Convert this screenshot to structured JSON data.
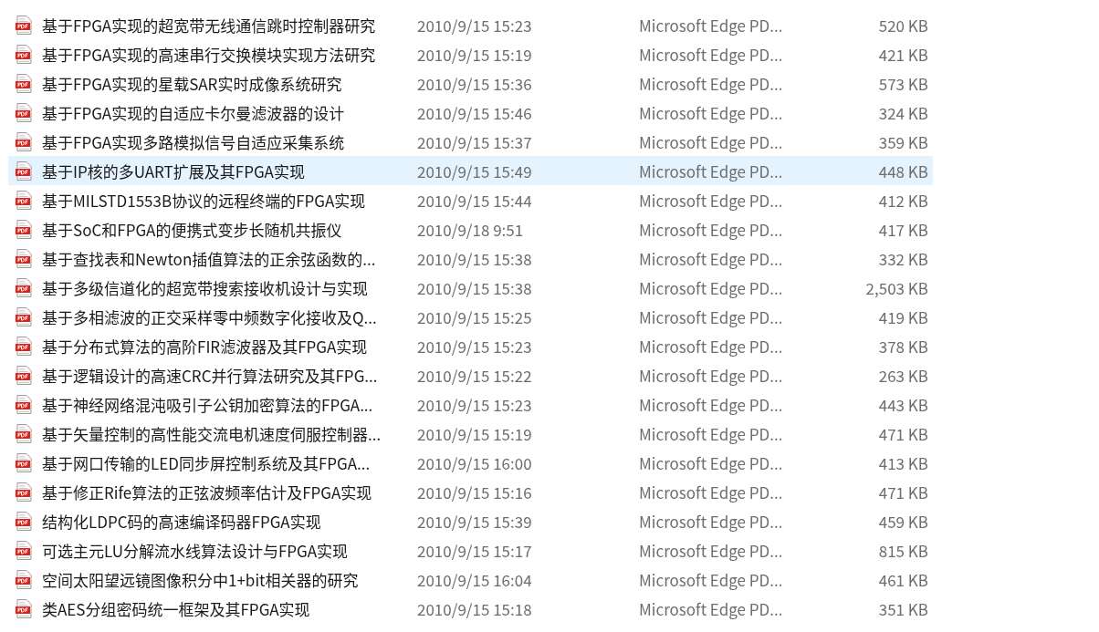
{
  "files": [
    {
      "name": "基于FPGA实现的超宽带无线通信跳时控制器研究",
      "date": "2010/9/15 15:23",
      "type": "Microsoft Edge PD...",
      "size": "520 KB",
      "highlighted": false
    },
    {
      "name": "基于FPGA实现的高速串行交换模块实现方法研究",
      "date": "2010/9/15 15:19",
      "type": "Microsoft Edge PD...",
      "size": "421 KB",
      "highlighted": false
    },
    {
      "name": "基于FPGA实现的星载SAR实时成像系统研究",
      "date": "2010/9/15 15:36",
      "type": "Microsoft Edge PD...",
      "size": "573 KB",
      "highlighted": false
    },
    {
      "name": "基于FPGA实现的自适应卡尔曼滤波器的设计",
      "date": "2010/9/15 15:46",
      "type": "Microsoft Edge PD...",
      "size": "324 KB",
      "highlighted": false
    },
    {
      "name": "基于FPGA实现多路模拟信号自适应采集系统",
      "date": "2010/9/15 15:37",
      "type": "Microsoft Edge PD...",
      "size": "359 KB",
      "highlighted": false
    },
    {
      "name": "基于IP核的多UART扩展及其FPGA实现",
      "date": "2010/9/15 15:49",
      "type": "Microsoft Edge PD...",
      "size": "448 KB",
      "highlighted": true
    },
    {
      "name": "基于MILSTD1553B协议的远程终端的FPGA实现",
      "date": "2010/9/15 15:44",
      "type": "Microsoft Edge PD...",
      "size": "412 KB",
      "highlighted": false
    },
    {
      "name": "基于SoC和FPGA的便携式变步长随机共振仪",
      "date": "2010/9/18 9:51",
      "type": "Microsoft Edge PD...",
      "size": "417 KB",
      "highlighted": false
    },
    {
      "name": "基于查找表和Newton插值算法的正余弦函数的...",
      "date": "2010/9/15 15:38",
      "type": "Microsoft Edge PD...",
      "size": "332 KB",
      "highlighted": false
    },
    {
      "name": "基于多级信道化的超宽带搜索接收机设计与实现",
      "date": "2010/9/15 15:38",
      "type": "Microsoft Edge PD...",
      "size": "2,503 KB",
      "highlighted": false
    },
    {
      "name": "基于多相滤波的正交采样零中频数字化接收及Q...",
      "date": "2010/9/15 15:25",
      "type": "Microsoft Edge PD...",
      "size": "419 KB",
      "highlighted": false
    },
    {
      "name": "基于分布式算法的高阶FIR滤波器及其FPGA实现",
      "date": "2010/9/15 15:23",
      "type": "Microsoft Edge PD...",
      "size": "378 KB",
      "highlighted": false
    },
    {
      "name": "基于逻辑设计的高速CRC并行算法研究及其FPG...",
      "date": "2010/9/15 15:22",
      "type": "Microsoft Edge PD...",
      "size": "263 KB",
      "highlighted": false
    },
    {
      "name": "基于神经网络混沌吸引子公钥加密算法的FPGA...",
      "date": "2010/9/15 15:23",
      "type": "Microsoft Edge PD...",
      "size": "443 KB",
      "highlighted": false
    },
    {
      "name": "基于矢量控制的高性能交流电机速度伺服控制器...",
      "date": "2010/9/15 15:19",
      "type": "Microsoft Edge PD...",
      "size": "471 KB",
      "highlighted": false
    },
    {
      "name": "基于网口传输的LED同步屏控制系统及其FPGA...",
      "date": "2010/9/15 16:00",
      "type": "Microsoft Edge PD...",
      "size": "413 KB",
      "highlighted": false
    },
    {
      "name": "基于修正Rife算法的正弦波频率估计及FPGA实现",
      "date": "2010/9/15 15:16",
      "type": "Microsoft Edge PD...",
      "size": "471 KB",
      "highlighted": false
    },
    {
      "name": "结构化LDPC码的高速编译码器FPGA实现",
      "date": "2010/9/15 15:39",
      "type": "Microsoft Edge PD...",
      "size": "459 KB",
      "highlighted": false
    },
    {
      "name": "可选主元LU分解流水线算法设计与FPGA实现",
      "date": "2010/9/15 15:17",
      "type": "Microsoft Edge PD...",
      "size": "815 KB",
      "highlighted": false
    },
    {
      "name": "空间太阳望远镜图像积分中1+bit相关器的研究",
      "date": "2010/9/15 16:04",
      "type": "Microsoft Edge PD...",
      "size": "461 KB",
      "highlighted": false
    },
    {
      "name": "类AES分组密码统一框架及其FPGA实现",
      "date": "2010/9/15 15:18",
      "type": "Microsoft Edge PD...",
      "size": "351 KB",
      "highlighted": false
    }
  ]
}
